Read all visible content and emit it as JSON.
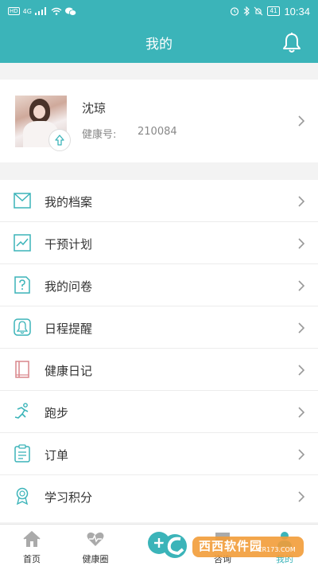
{
  "status_bar": {
    "left_badges": [
      "HD",
      "4G"
    ],
    "time": "10:34",
    "battery": "41"
  },
  "header": {
    "title": "我的"
  },
  "profile": {
    "name": "沈琼",
    "health_id_label": "健康号:",
    "health_id_value": "210084"
  },
  "menu": {
    "items": [
      {
        "label": "我的档案",
        "icon": "archive-icon"
      },
      {
        "label": "干预计划",
        "icon": "trend-chart-icon"
      },
      {
        "label": "我的问卷",
        "icon": "questionnaire-icon"
      },
      {
        "label": "日程提醒",
        "icon": "bell-reminder-icon"
      },
      {
        "label": "健康日记",
        "icon": "diary-book-icon"
      },
      {
        "label": "跑步",
        "icon": "running-icon"
      },
      {
        "label": "订单",
        "icon": "order-list-icon"
      },
      {
        "label": "学习积分",
        "icon": "medal-icon"
      }
    ]
  },
  "tabbar": {
    "tabs": [
      {
        "label": "首页",
        "icon": "home-icon"
      },
      {
        "label": "健康圈",
        "icon": "heartbeat-icon"
      },
      {
        "label": "咨询",
        "icon": "chat-icon"
      },
      {
        "label": "我的",
        "icon": "user-icon"
      }
    ]
  },
  "watermark": {
    "brand": "西西软件园",
    "url": "CR173.COM"
  },
  "colors": {
    "primary": "#3bb4b9",
    "diary": "#d9868b"
  }
}
